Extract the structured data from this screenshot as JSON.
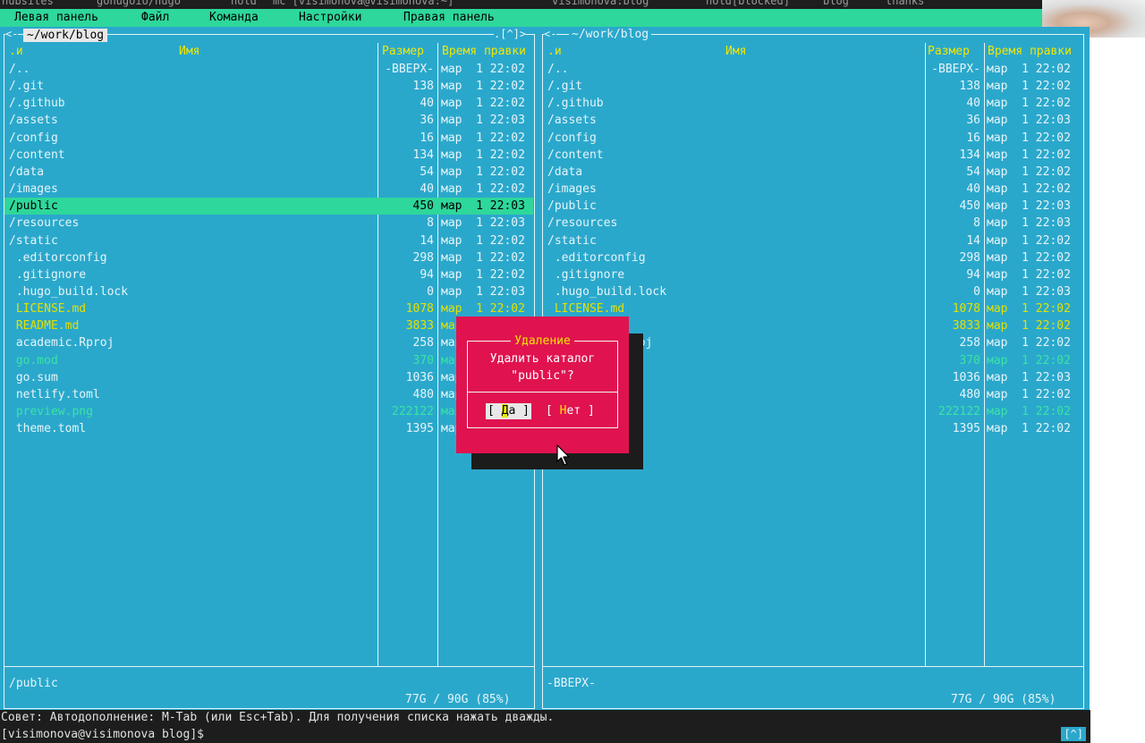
{
  "topbar": {
    "tabs": [
      "hubsites",
      "gohugoio/hugo",
      "hold",
      "mc [visimonova@visimonova:~]",
      "visimonova:blog",
      "hold[blocked]",
      "blog",
      "thanks"
    ]
  },
  "menu": {
    "items": [
      "Левая панель",
      "Файл",
      "Команда",
      "Настройки",
      "Правая панель"
    ]
  },
  "colors": {
    "panel_bg": "#2aa8cc",
    "menu_bg": "#2ed79b",
    "selection_bg": "#2ed79b",
    "dialog_bg": "#e0134f",
    "header_yellow": "#f2e600",
    "dir_color": "#e6f4f8",
    "highlight_file": "#e3e000",
    "image_file": "#3be3a5"
  },
  "left_panel": {
    "path": "~/work/blog",
    "corner": ".[^]>",
    "headers": {
      "sort": ".и",
      "name": "Имя",
      "size": "Размер",
      "time": "Время правки"
    },
    "rows": [
      {
        "name": "/..",
        "size": "-ВВЕРХ-",
        "time": "мар  1 22:02",
        "kind": "dir"
      },
      {
        "name": "/.git",
        "size": "138",
        "time": "мар  1 22:02",
        "kind": "dir"
      },
      {
        "name": "/.github",
        "size": "40",
        "time": "мар  1 22:02",
        "kind": "dir"
      },
      {
        "name": "/assets",
        "size": "36",
        "time": "мар  1 22:03",
        "kind": "dir"
      },
      {
        "name": "/config",
        "size": "16",
        "time": "мар  1 22:02",
        "kind": "dir"
      },
      {
        "name": "/content",
        "size": "134",
        "time": "мар  1 22:02",
        "kind": "dir"
      },
      {
        "name": "/data",
        "size": "54",
        "time": "мар  1 22:02",
        "kind": "dir"
      },
      {
        "name": "/images",
        "size": "40",
        "time": "мар  1 22:02",
        "kind": "dir"
      },
      {
        "name": "/public",
        "size": "450",
        "time": "мар  1 22:03",
        "kind": "selected"
      },
      {
        "name": "/resources",
        "size": "8",
        "time": "мар  1 22:03",
        "kind": "dir"
      },
      {
        "name": "/static",
        "size": "14",
        "time": "мар  1 22:02",
        "kind": "dir"
      },
      {
        "name": " .editorconfig",
        "size": "298",
        "time": "мар  1 22:02",
        "kind": "hidden"
      },
      {
        "name": " .gitignore",
        "size": "94",
        "time": "мар  1 22:02",
        "kind": "hidden"
      },
      {
        "name": " .hugo_build.lock",
        "size": "0",
        "time": "мар  1 22:03",
        "kind": "hidden"
      },
      {
        "name": " LICENSE.md",
        "size": "1078",
        "time": "мар  1 22:02",
        "kind": "doc"
      },
      {
        "name": " README.md",
        "size": "3833",
        "time": "мар  1 22:02",
        "kind": "doc"
      },
      {
        "name": " academic.Rproj",
        "size": "258",
        "time": "мар  1 22:02",
        "kind": "file"
      },
      {
        "name": " go.mod",
        "size": "370",
        "time": "мар  1 22:02",
        "kind": "green"
      },
      {
        "name": " go.sum",
        "size": "1036",
        "time": "мар  1 22:03",
        "kind": "file"
      },
      {
        "name": " netlify.toml",
        "size": "480",
        "time": "мар  1 22:02",
        "kind": "file"
      },
      {
        "name": " preview.png",
        "size": "222122",
        "time": "мар  1 22:02",
        "kind": "image"
      },
      {
        "name": " theme.toml",
        "size": "1395",
        "time": "мар  1 22:02",
        "kind": "file"
      }
    ],
    "status": "/public",
    "disk": "77G / 90G (85%)"
  },
  "right_panel": {
    "path": "~/work/blog",
    "corner_left": "<-",
    "corner_right": ".[^]>",
    "headers": {
      "sort": ".и",
      "name": "Имя",
      "size": "Размер",
      "time": "Время правки"
    },
    "rows": [
      {
        "name": "/..",
        "size": "-ВВЕРХ-",
        "time": "мар  1 22:02",
        "kind": "dir"
      },
      {
        "name": "/.git",
        "size": "138",
        "time": "мар  1 22:02",
        "kind": "dir"
      },
      {
        "name": "/.github",
        "size": "40",
        "time": "мар  1 22:02",
        "kind": "dir"
      },
      {
        "name": "/assets",
        "size": "36",
        "time": "мар  1 22:03",
        "kind": "dir"
      },
      {
        "name": "/config",
        "size": "16",
        "time": "мар  1 22:02",
        "kind": "dir"
      },
      {
        "name": "/content",
        "size": "134",
        "time": "мар  1 22:02",
        "kind": "dir"
      },
      {
        "name": "/data",
        "size": "54",
        "time": "мар  1 22:02",
        "kind": "dir"
      },
      {
        "name": "/images",
        "size": "40",
        "time": "мар  1 22:02",
        "kind": "dir"
      },
      {
        "name": "/public",
        "size": "450",
        "time": "мар  1 22:03",
        "kind": "dir"
      },
      {
        "name": "/resources",
        "size": "8",
        "time": "мар  1 22:03",
        "kind": "dir"
      },
      {
        "name": "/static",
        "size": "14",
        "time": "мар  1 22:02",
        "kind": "dir"
      },
      {
        "name": " .editorconfig",
        "size": "298",
        "time": "мар  1 22:02",
        "kind": "hidden"
      },
      {
        "name": " .gitignore",
        "size": "94",
        "time": "мар  1 22:02",
        "kind": "hidden"
      },
      {
        "name": " .hugo_build.lock",
        "size": "0",
        "time": "мар  1 22:03",
        "kind": "hidden"
      },
      {
        "name": " LICENSE.md",
        "size": "1078",
        "time": "мар  1 22:02",
        "kind": "doc"
      },
      {
        "name": " README.md",
        "size": "3833",
        "time": "мар  1 22:02",
        "kind": "doc"
      },
      {
        "name": " academic.Rproj",
        "size": "258",
        "time": "мар  1 22:02",
        "kind": "file"
      },
      {
        "name": " go.mod",
        "size": "370",
        "time": "мар  1 22:02",
        "kind": "green"
      },
      {
        "name": " go.sum",
        "size": "1036",
        "time": "мар  1 22:03",
        "kind": "file"
      },
      {
        "name": " netlify.toml",
        "size": "480",
        "time": "мар  1 22:02",
        "kind": "file"
      },
      {
        "name": " preview.png",
        "size": "222122",
        "time": "мар  1 22:02",
        "kind": "image"
      },
      {
        "name": " theme.toml",
        "size": "1395",
        "time": "мар  1 22:02",
        "kind": "file"
      }
    ],
    "status": "-ВВЕРХ-",
    "disk": "77G / 90G (85%)"
  },
  "dialog": {
    "title": "Удаление",
    "message_line1": "Удалить каталог",
    "message_line2": "\"public\"?",
    "yes_open": "[ ",
    "yes_hot": "Д",
    "yes_rest": "а ]",
    "no_open": "[ ",
    "no_hot": "Н",
    "no_rest": "ет ]"
  },
  "hint": "Совет: Автодополнение: M-Tab (или Esc+Tab). Для получения списка нажать дважды.",
  "prompt": "[visimonova@visimonova blog]$",
  "prompt_caret": "[^]"
}
